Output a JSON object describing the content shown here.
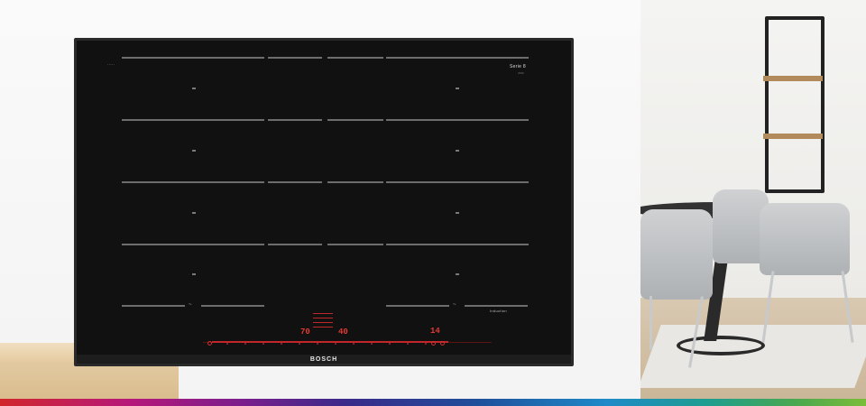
{
  "hob": {
    "brand": "BOSCH",
    "serie_label": "Serie 8",
    "series_text": "Induction",
    "display_left": "70",
    "display_mid": "40",
    "display_right": "14"
  },
  "colors": {
    "accent_red": "#e23a32",
    "glass": "#111111"
  }
}
